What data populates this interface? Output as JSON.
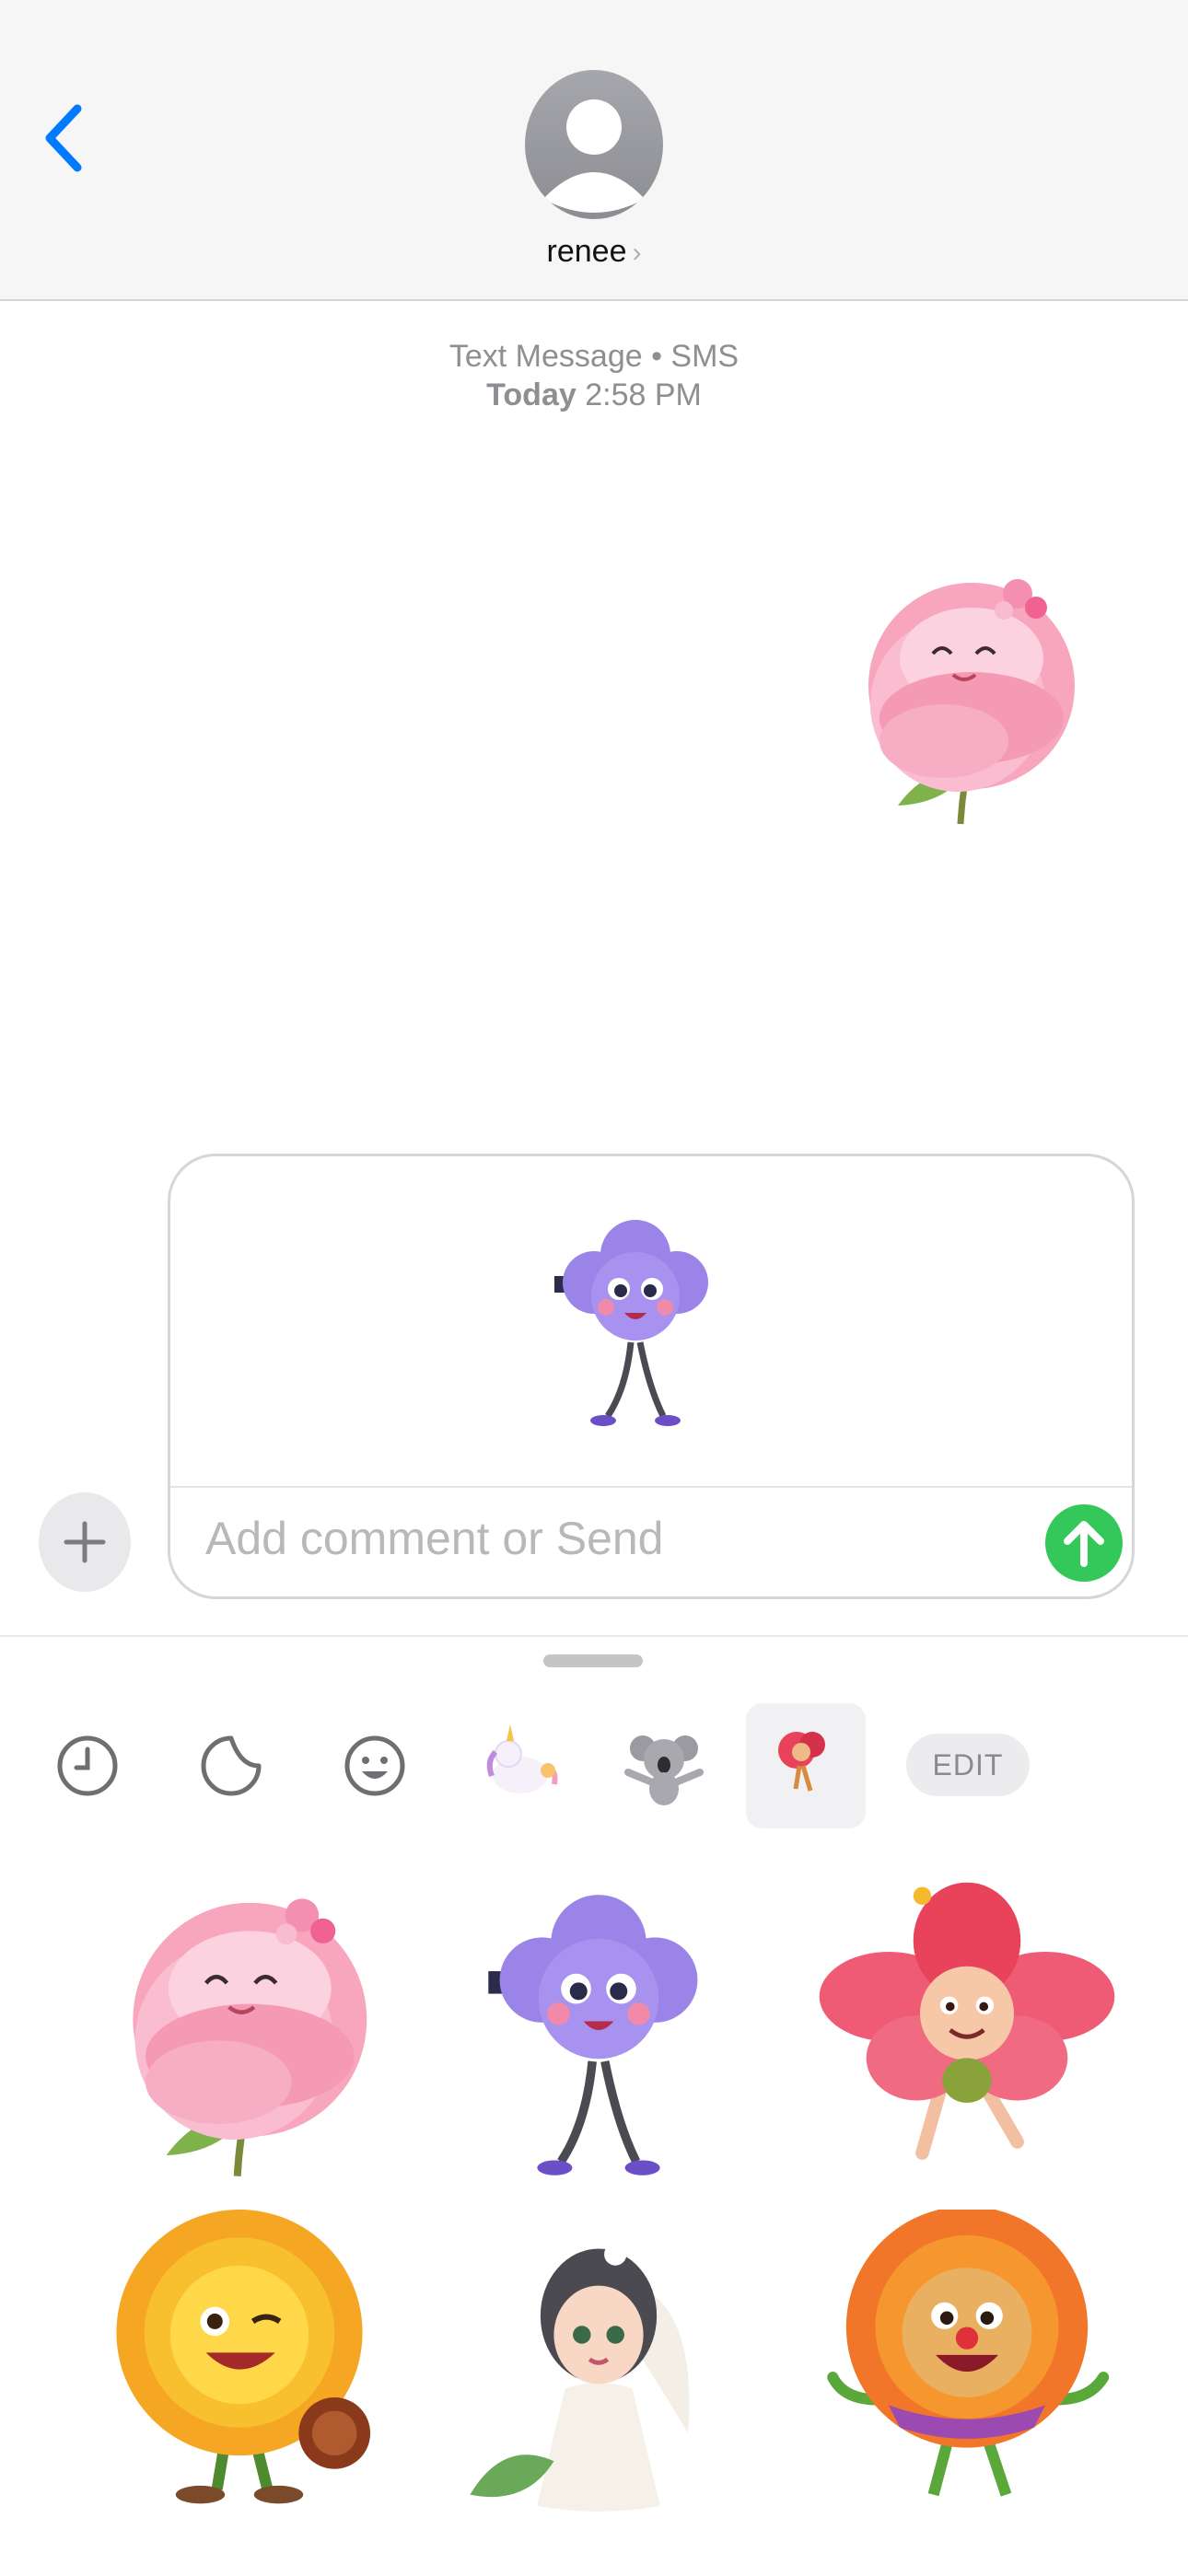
{
  "header": {
    "contact_name": "renee",
    "contact_chevron": "›",
    "back_icon": "chevron-left-icon",
    "accent_color": "#007aff"
  },
  "conversation": {
    "service_label": "Text Message • SMS",
    "timestamp_day": "Today",
    "timestamp_time": "2:58 PM",
    "sent_sticker": "pink-peony-sticker"
  },
  "compose": {
    "attached_sticker": "purple-flower-character-sticker",
    "placeholder": "Add comment or Send",
    "send_color": "#34c759"
  },
  "tray": {
    "tabs": [
      "clock-icon",
      "sticker-icon",
      "emoji-icon",
      "unicorn-sticker-pack",
      "koala-sticker-pack",
      "flower-sticker-pack"
    ],
    "selected_tab": "flower-sticker-pack",
    "edit_label": "EDIT",
    "stickers": [
      "pink-peony-sticker",
      "purple-flower-character-sticker",
      "red-flower-character-sticker",
      "winking-sunflower-sticker",
      "bride-girl-sticker",
      "orange-daisy-clown-sticker"
    ]
  }
}
